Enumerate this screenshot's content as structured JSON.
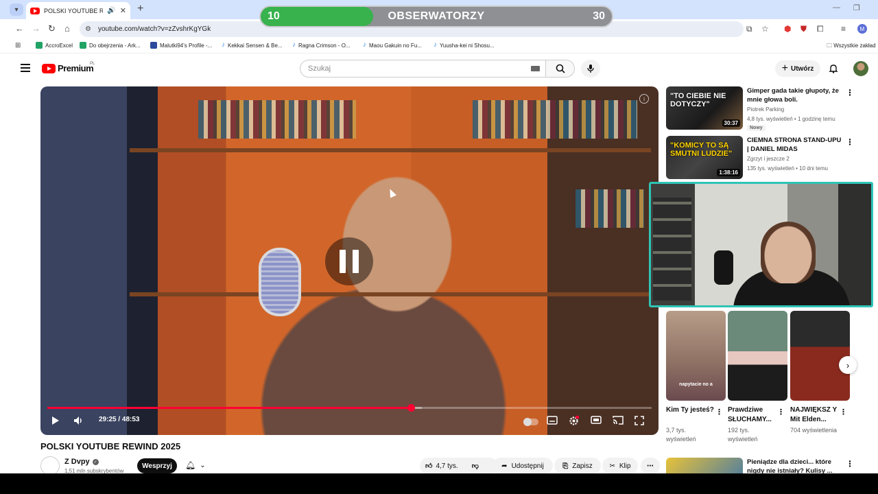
{
  "browser": {
    "tab_title": "POLSKI YOUTUBE REWIND",
    "url": "youtube.com/watch?v=zZvshrKgYGk",
    "bookmarks": [
      {
        "label": "AccroExcel",
        "icon": "sheets-icon"
      },
      {
        "label": "Do obejrzenia - Ark...",
        "icon": "sheets-icon"
      },
      {
        "label": "Malutki94's Profile -...",
        "icon": "mal-icon"
      },
      {
        "label": "Kekkai Sensen & Be...",
        "icon": "anime-icon"
      },
      {
        "label": "Ragna Crimson - O...",
        "icon": "anime-icon"
      },
      {
        "label": "Maou Gakuin no Fu...",
        "icon": "anime-icon"
      },
      {
        "label": "Yuusha-kei ni Shosu...",
        "icon": "anime-icon"
      }
    ],
    "bookmarks_folder": "Wszystkie zakład",
    "profile_initial": "M"
  },
  "poll": {
    "left_value": "10",
    "label": "OBSERWATORZY",
    "right_value": "30",
    "left_fraction": 0.32,
    "left_color": "#37b24d"
  },
  "youtube": {
    "logo_text": "Premium",
    "region": "PL",
    "search_placeholder": "Szukaj",
    "create_label": "Utwórz"
  },
  "player": {
    "time": "29:25 / 48:53",
    "progress": 0.6018,
    "buffer": 0.62
  },
  "video": {
    "title": "POLSKI YOUTUBE REWIND 2025",
    "channel": "Z Dvpy",
    "subscribers": "1,51 mln subskrybentów",
    "support_label": "Wesprzyj",
    "likes": "4,7 tys.",
    "share_label": "Udostępnij",
    "save_label": "Zapisz",
    "clip_label": "Klip"
  },
  "recommendations": [
    {
      "thumb_text": "\"TO CIEBIE NIE DOTYCZY\"",
      "duration": "30:37",
      "title": "Gimper gada takie głupoty, że mnie głowa boli.",
      "channel": "Piotrek Parking",
      "meta": "4,8 tys. wyświetleń • 1 godzinę temu",
      "badge": "Nowy"
    },
    {
      "thumb_text": "\"KOMICY TO SĄ SMUTNI LUDZIE\"",
      "duration": "1:38:16",
      "title": "CIEMNA STRONA STAND-UPU | DANIEL MIDAS",
      "channel": "Zgrzyt i jeszcze 2",
      "meta": "135 tys. wyświetleń • 10 dni temu"
    },
    {
      "title": "Pieniądze dla dzieci... które nigdy nie istniały? Kulisy ..."
    }
  ],
  "shorts": [
    {
      "caption": "napytacie no a",
      "title": "Kim Ty jesteś?",
      "views": "3,7 tys. wyświetleń"
    },
    {
      "title": "Prawdziwe SŁUCHAMY...",
      "views": "192 tys. wyświetleń"
    },
    {
      "title": "NAJWIĘKSZ Y Mit Elden...",
      "views": "704 wyświetlenia"
    }
  ]
}
